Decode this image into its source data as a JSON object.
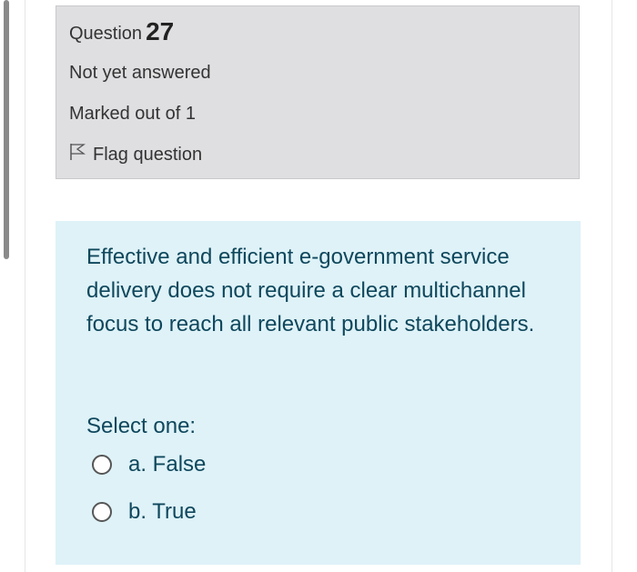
{
  "info": {
    "question_label": "Question",
    "question_number": "27",
    "state": "Not yet answered",
    "grade": "Marked out of 1",
    "flag_label": "Flag question"
  },
  "question": {
    "text": "Effective and efficient e-government service delivery does not require a clear multichannel focus to reach all relevant public stakeholders.",
    "prompt": "Select one:",
    "options": [
      {
        "label": "a. False",
        "selected": false
      },
      {
        "label": "b. True",
        "selected": false
      }
    ]
  },
  "colors": {
    "info_background": "#dfdfe2",
    "question_background": "#def2f8",
    "question_text": "#0f475c"
  },
  "icons": {
    "flag": "flag-outline-icon",
    "radio": "radio-unchecked-icon"
  }
}
